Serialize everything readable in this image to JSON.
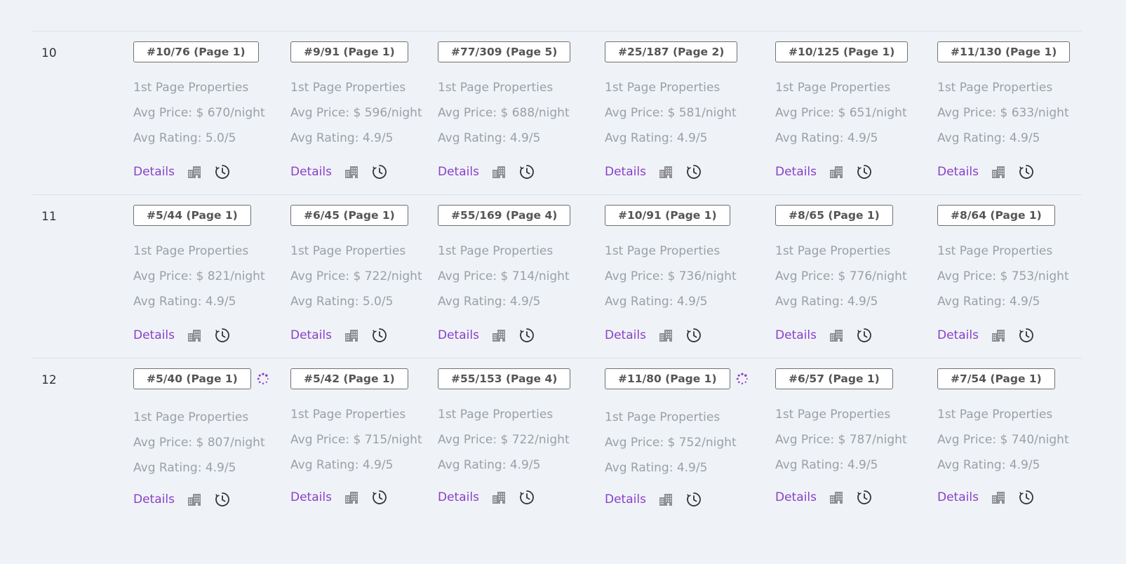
{
  "action_labels": {
    "details": "Details"
  },
  "icons": {
    "building": "building-icon",
    "history": "clock-history-icon",
    "spinner": "loading-spinner-icon"
  },
  "colors": {
    "link": "#8a3fc7",
    "muted_text": "#9aa0a6",
    "background": "#eff3f7"
  },
  "rows": [
    {
      "number": "",
      "cells": [
        {
          "rank": "",
          "label": "",
          "price": "",
          "rating": "",
          "loading": false
        },
        {
          "rank": "",
          "label": "",
          "price": "",
          "rating": "",
          "loading": false
        },
        {
          "rank": "",
          "label": "",
          "price": "",
          "rating": "",
          "loading": false
        },
        {
          "rank": "",
          "label": "",
          "price": "",
          "rating": "",
          "loading": false
        },
        {
          "rank": "",
          "label": "",
          "price": "",
          "rating": "",
          "loading": false
        },
        {
          "rank": "",
          "label": "",
          "price": "",
          "rating": "",
          "loading": false
        }
      ]
    },
    {
      "number": "10",
      "cells": [
        {
          "rank": "#10/76 (Page 1)",
          "label": "1st Page Properties",
          "price": "Avg Price: $ 670/night",
          "rating": "Avg Rating: 5.0/5",
          "loading": false
        },
        {
          "rank": "#9/91 (Page 1)",
          "label": "1st Page Properties",
          "price": "Avg Price: $ 596/night",
          "rating": "Avg Rating: 4.9/5",
          "loading": false
        },
        {
          "rank": "#77/309 (Page 5)",
          "label": "1st Page Properties",
          "price": "Avg Price: $ 688/night",
          "rating": "Avg Rating: 4.9/5",
          "loading": false
        },
        {
          "rank": "#25/187 (Page 2)",
          "label": "1st Page Properties",
          "price": "Avg Price: $ 581/night",
          "rating": "Avg Rating: 4.9/5",
          "loading": false
        },
        {
          "rank": "#10/125 (Page 1)",
          "label": "1st Page Properties",
          "price": "Avg Price: $ 651/night",
          "rating": "Avg Rating: 4.9/5",
          "loading": false
        },
        {
          "rank": "#11/130 (Page 1)",
          "label": "1st Page Properties",
          "price": "Avg Price: $ 633/night",
          "rating": "Avg Rating: 4.9/5",
          "loading": false
        }
      ]
    },
    {
      "number": "11",
      "cells": [
        {
          "rank": "#5/44 (Page 1)",
          "label": "1st Page Properties",
          "price": "Avg Price: $ 821/night",
          "rating": "Avg Rating: 4.9/5",
          "loading": false
        },
        {
          "rank": "#6/45 (Page 1)",
          "label": "1st Page Properties",
          "price": "Avg Price: $ 722/night",
          "rating": "Avg Rating: 5.0/5",
          "loading": false
        },
        {
          "rank": "#55/169 (Page 4)",
          "label": "1st Page Properties",
          "price": "Avg Price: $ 714/night",
          "rating": "Avg Rating: 4.9/5",
          "loading": false
        },
        {
          "rank": "#10/91 (Page 1)",
          "label": "1st Page Properties",
          "price": "Avg Price: $ 736/night",
          "rating": "Avg Rating: 4.9/5",
          "loading": false
        },
        {
          "rank": "#8/65 (Page 1)",
          "label": "1st Page Properties",
          "price": "Avg Price: $ 776/night",
          "rating": "Avg Rating: 4.9/5",
          "loading": false
        },
        {
          "rank": "#8/64 (Page 1)",
          "label": "1st Page Properties",
          "price": "Avg Price: $ 753/night",
          "rating": "Avg Rating: 4.9/5",
          "loading": false
        }
      ]
    },
    {
      "number": "12",
      "cells": [
        {
          "rank": "#5/40 (Page 1)",
          "label": "1st Page Properties",
          "price": "Avg Price: $ 807/night",
          "rating": "Avg Rating: 4.9/5",
          "loading": true
        },
        {
          "rank": "#5/42 (Page 1)",
          "label": "1st Page Properties",
          "price": "Avg Price: $ 715/night",
          "rating": "Avg Rating: 4.9/5",
          "loading": false
        },
        {
          "rank": "#55/153 (Page 4)",
          "label": "1st Page Properties",
          "price": "Avg Price: $ 722/night",
          "rating": "Avg Rating: 4.9/5",
          "loading": false
        },
        {
          "rank": "#11/80 (Page 1)",
          "label": "1st Page Properties",
          "price": "Avg Price: $ 752/night",
          "rating": "Avg Rating: 4.9/5",
          "loading": true
        },
        {
          "rank": "#6/57 (Page 1)",
          "label": "1st Page Properties",
          "price": "Avg Price: $ 787/night",
          "rating": "Avg Rating: 4.9/5",
          "loading": false
        },
        {
          "rank": "#7/54 (Page 1)",
          "label": "1st Page Properties",
          "price": "Avg Price: $ 740/night",
          "rating": "Avg Rating: 4.9/5",
          "loading": false
        }
      ]
    }
  ]
}
